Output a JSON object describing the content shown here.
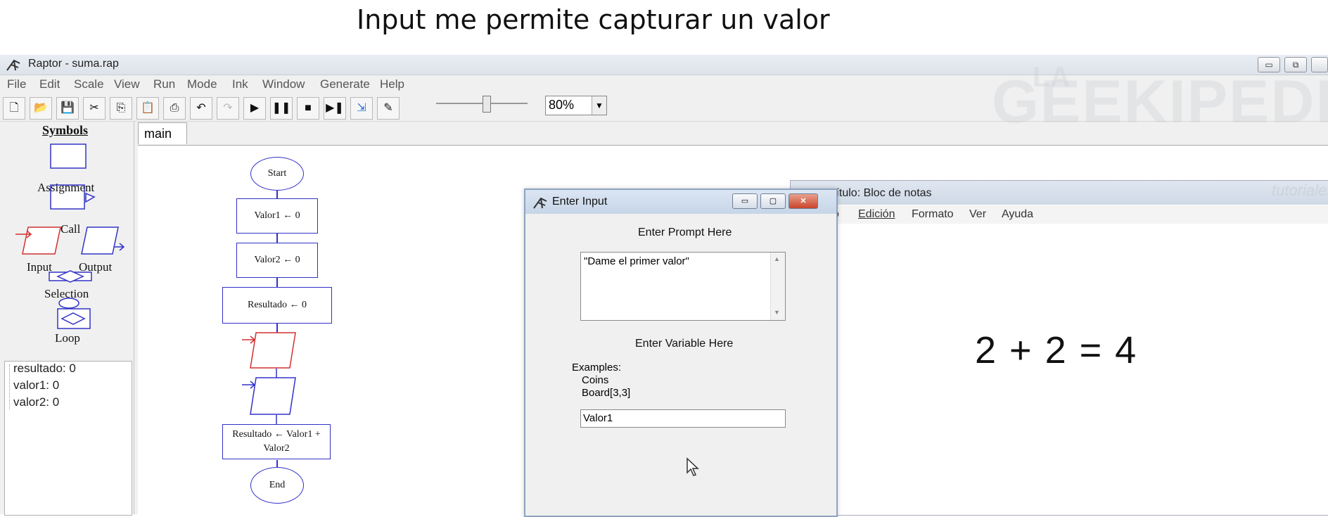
{
  "caption": "Input me permite capturar un valor",
  "window": {
    "title": "Raptor - suma.rap"
  },
  "menu": [
    "File",
    "Edit",
    "Scale",
    "View",
    "Run",
    "Mode",
    "Ink",
    "Window",
    "Generate",
    "Help"
  ],
  "zoom": {
    "value": "80%"
  },
  "palette": {
    "title": "Symbols",
    "assignment": "Assignment",
    "call": "Call",
    "input": "Input",
    "output": "Output",
    "selection": "Selection",
    "loop": "Loop"
  },
  "variables": [
    "resultado: 0",
    "valor1: 0",
    "valor2: 0"
  ],
  "tab": "main",
  "flowchart": {
    "start": "Start",
    "step1": "Valor1 ← 0",
    "step2": "Valor2 ← 0",
    "step3": "Resultado ← 0",
    "step4": "Resultado ← Valor1 + Valor2",
    "end": "End"
  },
  "notepad": {
    "title": "título: Bloc de notas",
    "menu": [
      "o",
      "Edición",
      "Formato",
      "Ver",
      "Ayuda"
    ],
    "text": "2 + 2 = 4",
    "watermark_top": "LA",
    "watermark": "GEEKIPEDIA",
    "tutoriales": "tutoriales"
  },
  "dialog": {
    "title": "Enter Input",
    "prompt_label": "Enter Prompt Here",
    "prompt_value": "\"Dame el primer valor\"",
    "variable_label": "Enter Variable Here",
    "examples_label": "Examples:",
    "example1": "Coins",
    "example2": "Board[3,3]",
    "variable_value": "Valor1"
  }
}
